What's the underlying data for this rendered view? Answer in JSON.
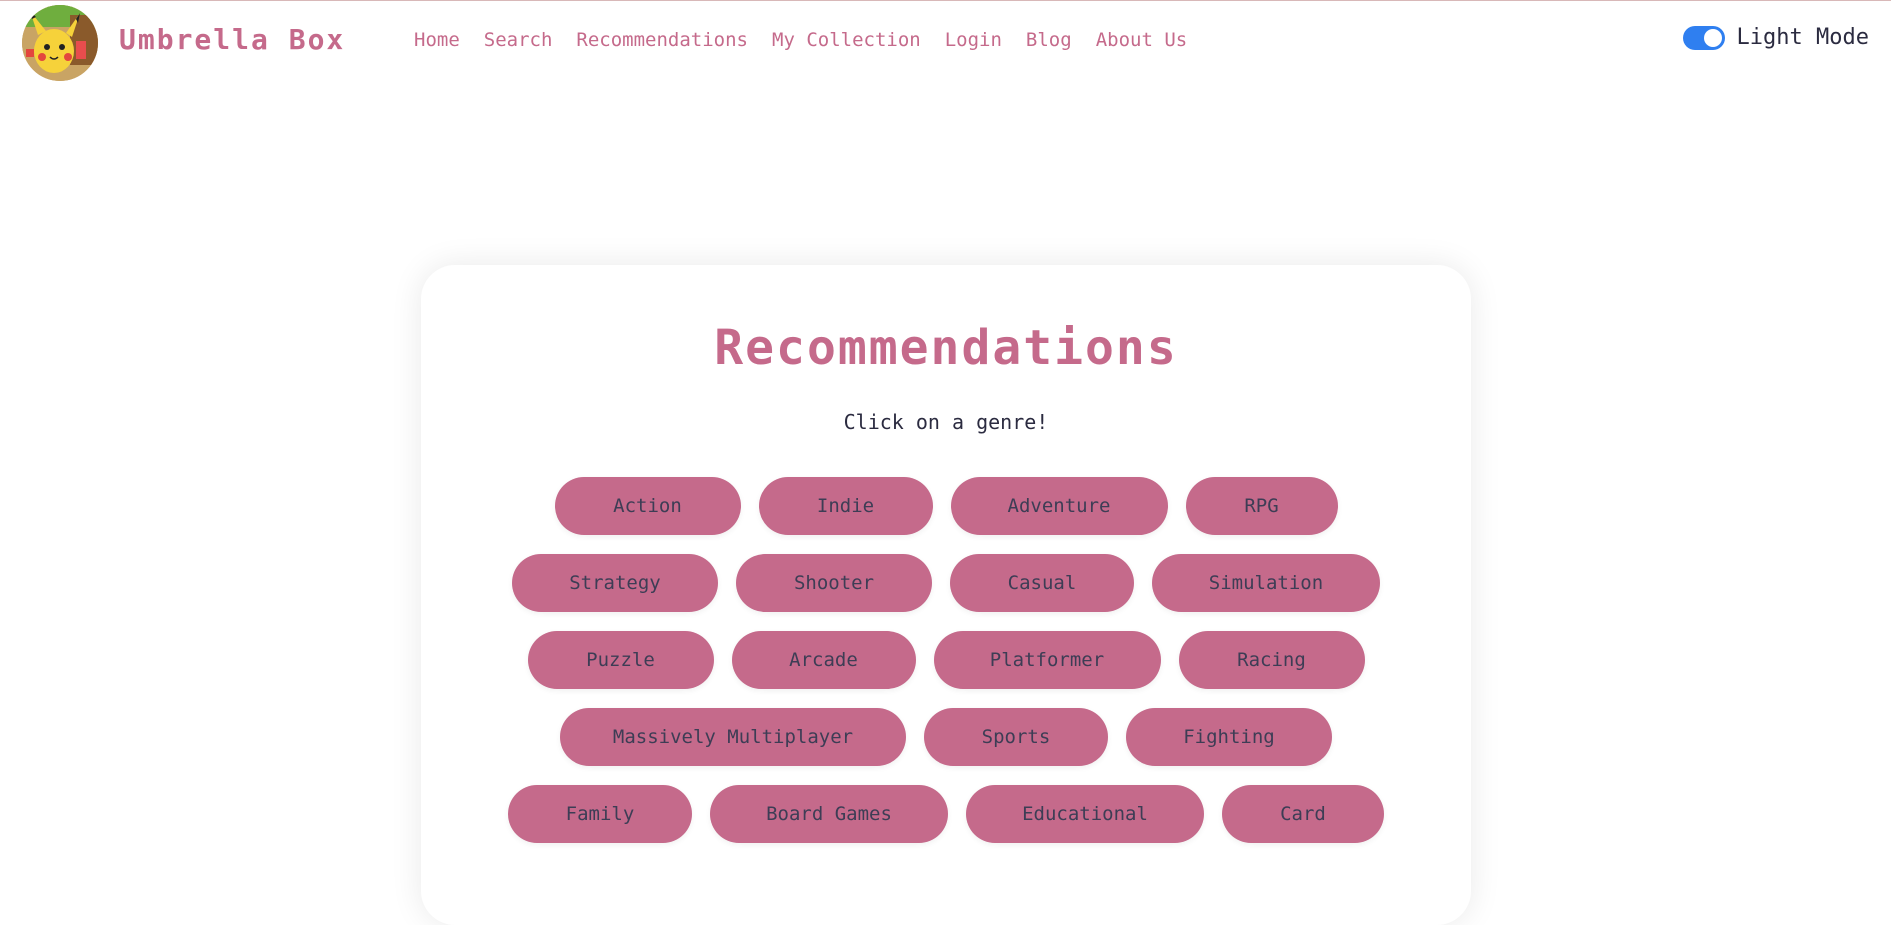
{
  "header": {
    "brand": "Umbrella Box",
    "nav": [
      "Home",
      "Search",
      "Recommendations",
      "My Collection",
      "Login",
      "Blog",
      "About Us"
    ],
    "toggle_label": "Light Mode"
  },
  "main": {
    "title": "Recommendations",
    "subtitle": "Click on a genre!",
    "genres": [
      [
        "Action",
        "Indie",
        "Adventure",
        "RPG"
      ],
      [
        "Strategy",
        "Shooter",
        "Casual",
        "Simulation"
      ],
      [
        "Puzzle",
        "Arcade",
        "Platformer",
        "Racing"
      ],
      [
        "Massively Multiplayer",
        "Sports",
        "Fighting"
      ],
      [
        "Family",
        "Board Games",
        "Educational",
        "Card"
      ]
    ]
  },
  "colors": {
    "accent": "#c56a8b",
    "toggle": "#2f7ff0",
    "text_dark": "#2b2b40"
  },
  "icons": {
    "logo": "pikachu-avatar-logo"
  }
}
